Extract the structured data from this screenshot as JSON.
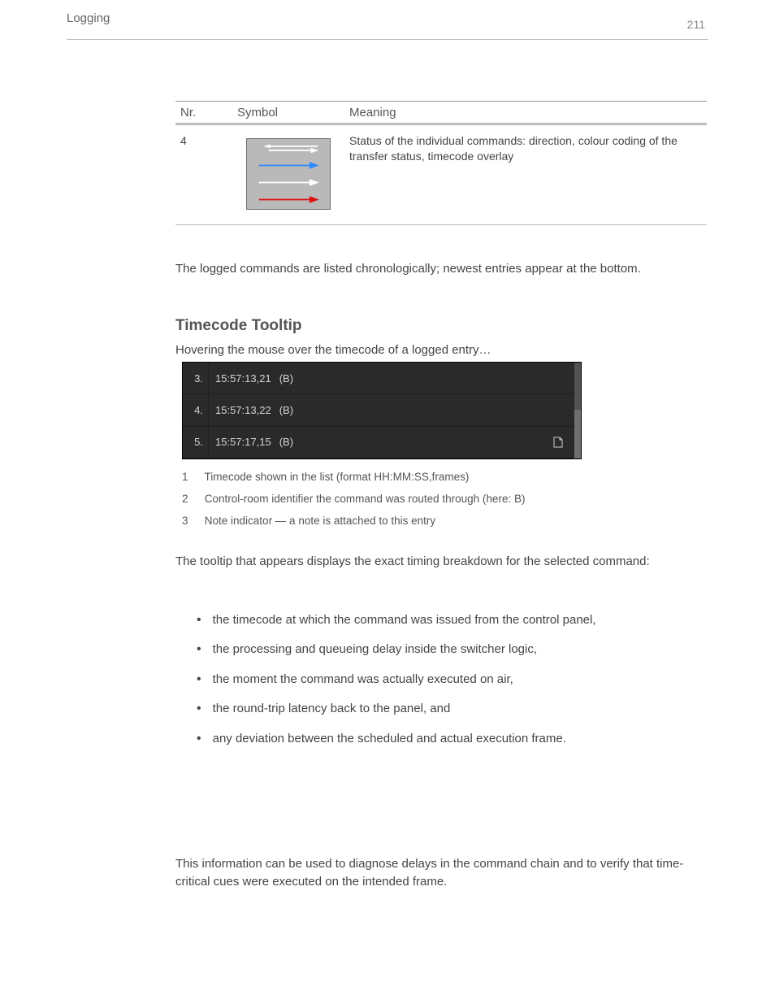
{
  "page_number": "211",
  "header": {
    "section": "Logging"
  },
  "table": {
    "headers": [
      "Nr.",
      "Symbol",
      "Meaning"
    ],
    "row": {
      "nr": "4",
      "symbol_label": "timing-arrows-icon",
      "meaning": "Status of the individual commands: direction, colour coding of the transfer status, timecode overlay"
    }
  },
  "paragraph_after_table": "The logged commands are listed chronologically; newest entries appear at the bottom.",
  "heading": "Timecode Tooltip",
  "intro": "Hovering the mouse over the timecode of a logged entry…",
  "ui_rows": [
    {
      "n": "3.",
      "tc": "15:57:13,21",
      "suffix": "(B)"
    },
    {
      "n": "4.",
      "tc": "15:57:13,22",
      "suffix": "(B)"
    },
    {
      "n": "5.",
      "tc": "15:57:17,15",
      "suffix": "(B)",
      "has_icon": true
    }
  ],
  "callouts": [
    {
      "n": "1",
      "text": "Timecode shown in the list (format HH:MM:SS,frames)"
    },
    {
      "n": "2",
      "text": "Control-room identifier the command was routed through (here: B)"
    },
    {
      "n": "3",
      "text": "Note indicator — a note is attached to this entry"
    }
  ],
  "paragraph_mid": "The tooltip that appears displays the exact timing breakdown for the selected command:",
  "bullets": [
    "the timecode at which the command was issued from the control panel,",
    "the processing and queueing delay inside the switcher logic,",
    "the moment the command was actually executed on air,",
    "the round-trip latency back to the panel, and",
    "any deviation between the scheduled and actual execution frame."
  ],
  "paragraph_bottom": "This information can be used to diagnose delays in the command chain and to verify that time-critical cues were executed on the intended frame."
}
